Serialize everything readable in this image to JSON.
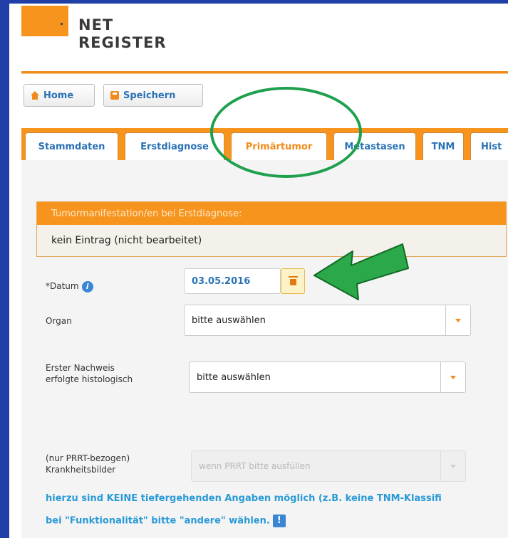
{
  "logo": {
    "line1": "NET",
    "line2": "REGISTER"
  },
  "toolbar": {
    "home_label": "Home",
    "save_label": "Speichern"
  },
  "tabs": [
    {
      "label": "Stammdaten"
    },
    {
      "label": "Erstdiagnose"
    },
    {
      "label": "Primärtumor"
    },
    {
      "label": "Metastasen"
    },
    {
      "label": "TNM"
    },
    {
      "label": "Hist"
    }
  ],
  "active_tab": "Primärtumor",
  "panel": {
    "header": "Tumormanifestation/en bei Erstdiagnose:",
    "body": "kein Eintrag (nicht bearbeitet)"
  },
  "form": {
    "datum_label": "*Datum",
    "datum_value": "03.05.2016",
    "organ_label": "Organ",
    "organ_value": "bitte auswählen",
    "nachweis_label_1": "Erster Nachweis",
    "nachweis_label_2": "erfolgte histologisch",
    "nachweis_value": "bitte auswählen",
    "prrt_label_1": "(nur PRRT-bezogen)",
    "prrt_label_2": "Krankheitsbilder",
    "prrt_placeholder": "wenn PRRT bitte ausfüllen"
  },
  "notes": {
    "line1": "hierzu sind KEINE tiefergehenden Angaben möglich (z.B. keine TNM-Klassifi",
    "line2": "bei \"Funktionalität\" bitte \"andere\" wählen."
  },
  "colors": {
    "accent": "#f7941d",
    "link": "#2a72b5",
    "highlight_green": "#1fa04e",
    "frame_blue": "#1f3fa6"
  }
}
